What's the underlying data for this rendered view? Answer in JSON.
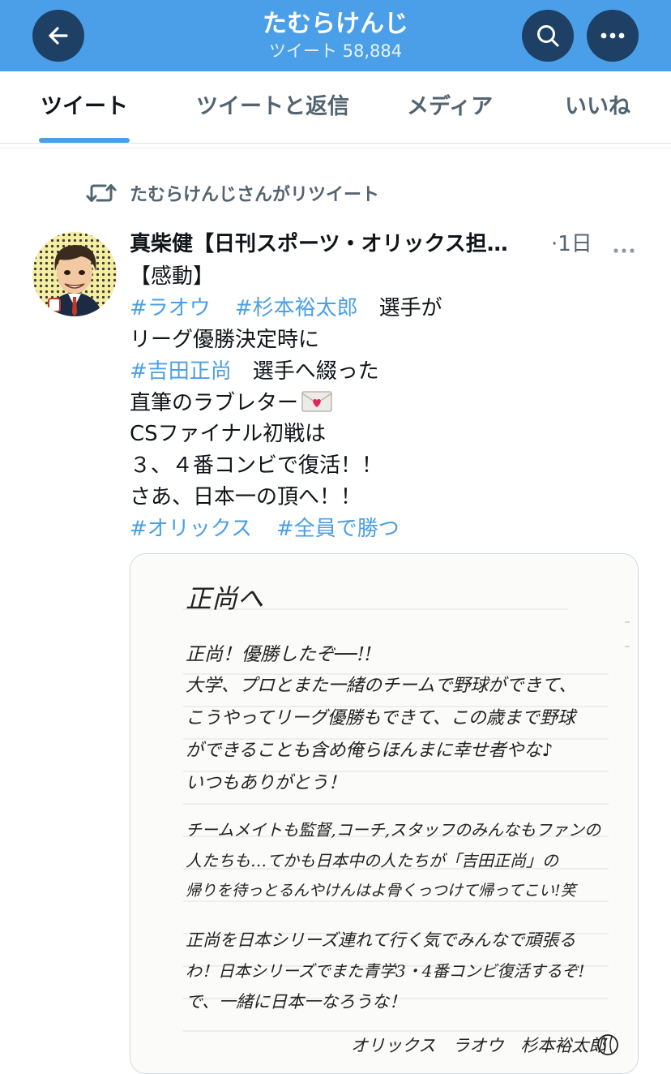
{
  "header": {
    "title": "たむらけんじ",
    "subtitle": "ツイート 58,884"
  },
  "tabs": [
    {
      "label": "ツイート",
      "active": true
    },
    {
      "label": "ツイートと返信",
      "active": false
    },
    {
      "label": "メディア",
      "active": false
    },
    {
      "label": "いいね",
      "active": false
    }
  ],
  "retweet": {
    "label": "たむらけんじさんがリツイート",
    "icon": "retweet-icon"
  },
  "tweet": {
    "author": "真柴健【日刊スポーツ・オリックス担…",
    "time": "·1日",
    "lines": {
      "l1": "【感動】",
      "l2_tag1": "#ラオウ",
      "l2_tag2": "#杉本裕太郎",
      "l2_text": "　選手が",
      "l3": "リーグ優勝決定時に",
      "l4_tag": "#吉田正尚",
      "l4_text": "　選手へ綴った",
      "l5": "直筆のラブレター",
      "l5_emoji": "💌",
      "l6": "CSファイナル初戦は",
      "l7": "３、４番コンビで復活！！",
      "l8": "さあ、日本一の頂へ！！",
      "l9_tag1": "#オリックス",
      "l9_tag2": "#全員で勝つ"
    }
  },
  "letter": {
    "heading": "正尚へ",
    "p1": "正尚！優勝したぞ──!!",
    "p2": "大学、プロとまた一緒のチームで野球ができて、",
    "p3": "こうやってリーグ優勝もできて、この歳まで野球",
    "p4": "ができることも含め俺らほんまに幸せ者やな♪",
    "p5": "いつもありがとう！",
    "p6": "チームメイトも監督,コーチ,スタッフのみんなもファンの",
    "p7": "人たちも…てかも日本中の人たちが「吉田正尚」の",
    "p8": "帰りを待っとるんやけんはよ骨くっつけて帰ってこい!笑",
    "p9": "正尚を日本シリーズ連れて行く気でみんなで頑張る",
    "p10": "わ！日本シリーズでまた青学3・4番コンビ復活するぞ!",
    "p11": "で、一緒に日本一なろうな！",
    "signature": "オリックス　ラオウ　杉本裕太郎"
  },
  "colors": {
    "header_bg": "#4a9fe8",
    "button_bg": "#1e4064",
    "link": "#4a9fe8",
    "muted": "#536471"
  }
}
